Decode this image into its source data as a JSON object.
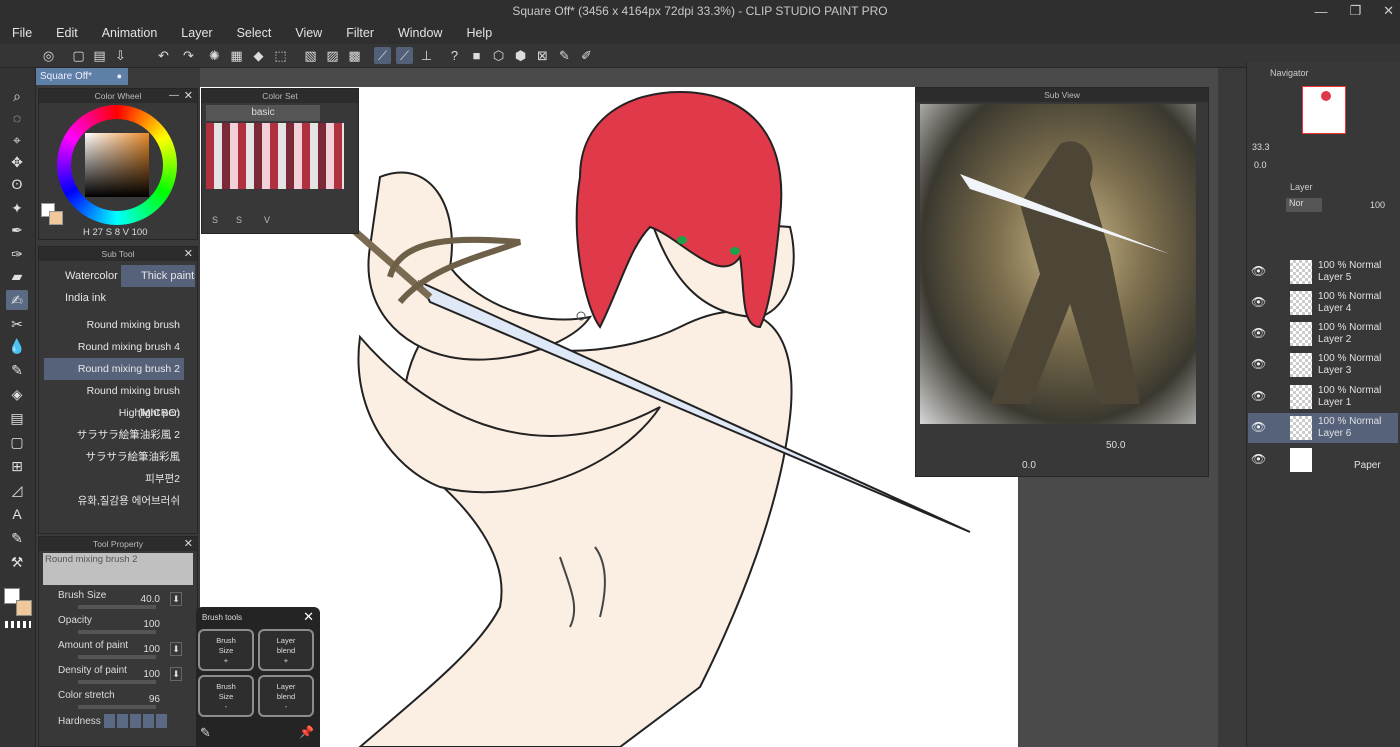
{
  "window": {
    "title": "Square Off* (3456 x 4164px 72dpi 33.3%) - CLIP STUDIO PAINT PRO",
    "controls": [
      "—",
      "❐",
      "✕"
    ]
  },
  "menu": [
    "File",
    "Edit",
    "Animation",
    "Layer",
    "Select",
    "View",
    "Filter",
    "Window",
    "Help"
  ],
  "doc_tab": "Square Off*",
  "color_wheel": {
    "title": "Color Wheel",
    "h_label": "H",
    "h_value": "27",
    "s_label": "S",
    "s_value": "8",
    "v_label": "V",
    "v_value": "100"
  },
  "color_set": {
    "title": "Color Set",
    "preset": "basic",
    "bottom_icons": [
      "S",
      "S",
      "V"
    ]
  },
  "sub_tool": {
    "title": "Sub Tool",
    "tabs": [
      "Watercolor",
      "Thick paint",
      "India ink"
    ],
    "brushes": [
      "Round mixing brush",
      "Round mixing brush 4",
      "Round mixing brush 2",
      "Round mixing brush (MICRO)",
      "Highlight pen",
      "サラサラ絵筆油彩風 2",
      "サラサラ絵筆油彩風",
      "피부편2",
      "유화,질감용 에어브러쉬"
    ]
  },
  "tool_property": {
    "title": "Tool Property",
    "brush_name": "Round mixing brush 2",
    "rows": [
      {
        "label": "Brush Size",
        "value": "40.0",
        "level": 0.4
      },
      {
        "label": "Opacity",
        "value": "100",
        "level": 1.0
      },
      {
        "label": "Amount of paint",
        "value": "100",
        "level": 1.0
      },
      {
        "label": "Density of paint",
        "value": "100",
        "level": 1.0
      },
      {
        "label": "Color stretch",
        "value": "96",
        "level": 0.96
      }
    ],
    "hardness_label": "Hardness"
  },
  "brush_tools": {
    "title": "Brush tools",
    "buttons": [
      {
        "l1": "Brush",
        "l2": "Size",
        "l3": "+"
      },
      {
        "l1": "Layer",
        "l2": "blend",
        "l3": "+"
      },
      {
        "l1": "Brush",
        "l2": "Size",
        "l3": "-"
      },
      {
        "l1": "Layer",
        "l2": "blend",
        "l3": "-"
      }
    ]
  },
  "sub_view": {
    "title": "Sub View",
    "zoom": "50.0",
    "rotation": "0.0"
  },
  "navigator": {
    "title": "Navigator",
    "zoom": "33.3",
    "angle": "0.0"
  },
  "layer_panel": {
    "title": "Layer",
    "blend_mode": "Nor",
    "opacity": "100",
    "layers": [
      {
        "mode": "100 % Normal",
        "name": "Layer 5"
      },
      {
        "mode": "100 % Normal",
        "name": "Layer 4"
      },
      {
        "mode": "100 % Normal",
        "name": "Layer 2"
      },
      {
        "mode": "100 % Normal",
        "name": "Layer 3"
      },
      {
        "mode": "100 % Normal",
        "name": "Layer 1"
      },
      {
        "mode": "100 % Normal",
        "name": "Layer 6"
      }
    ],
    "paper": "Paper"
  },
  "colors": {
    "accent": "#5b6a84",
    "hair": "#e0394a",
    "skin": "#fbeee2",
    "panel": "#383838"
  }
}
